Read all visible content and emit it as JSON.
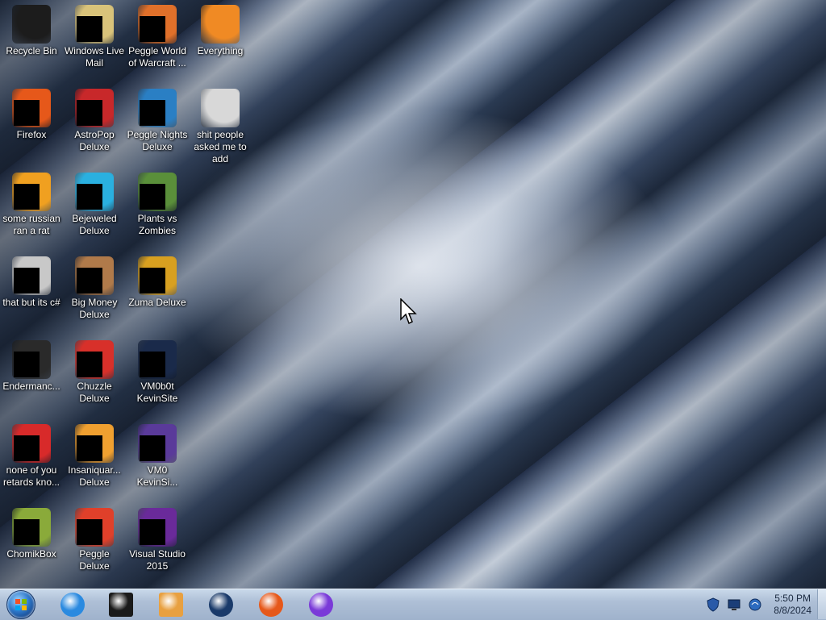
{
  "desktop": {
    "icons": [
      {
        "label": "Recycle Bin",
        "icon": "recycle-bin-icon",
        "color": "#1c1c1c"
      },
      {
        "label": "Windows Live\nMail",
        "icon": "mail-icon",
        "color": "#d9c37a"
      },
      {
        "label": "Peggle World\nof Warcraft ...",
        "icon": "peggle-wow-icon",
        "color": "#e0702a"
      },
      {
        "label": "Everything",
        "icon": "search-circle-icon",
        "color": "#f08a24"
      },
      {
        "label": "Firefox",
        "icon": "firefox-icon",
        "color": "#e6581a"
      },
      {
        "label": "AstroPop\nDeluxe",
        "icon": "astropop-icon",
        "color": "#c8282a"
      },
      {
        "label": "Peggle Nights\nDeluxe",
        "icon": "peggle-nights-icon",
        "color": "#2a7fc4"
      },
      {
        "label": "shit people\nasked me to\nadd",
        "icon": "folder-icon",
        "color": "#d8d8d8"
      },
      {
        "label": "some russian\nran a rat",
        "icon": "ae-app-icon",
        "color": "#f0a020"
      },
      {
        "label": "Bejeweled\nDeluxe",
        "icon": "bejeweled-icon",
        "color": "#2ab0e0"
      },
      {
        "label": "Plants vs\nZombies",
        "icon": "pvz-icon",
        "color": "#5a8f3a"
      },
      {
        "label": "that but its c#",
        "icon": "copy-windows-icon",
        "color": "#c8c8c8"
      },
      {
        "label": "Big Money\nDeluxe",
        "icon": "money-bag-icon",
        "color": "#b07a4a"
      },
      {
        "label": "Zuma Deluxe",
        "icon": "zuma-icon",
        "color": "#d8a020"
      },
      {
        "label": "Endermanc...",
        "icon": "terminal-window-icon",
        "color": "#2a2a2a"
      },
      {
        "label": "Chuzzle\nDeluxe",
        "icon": "chuzzle-icon",
        "color": "#d8302a"
      },
      {
        "label": "VM0b0t\nKevinSite",
        "icon": "vm-window-icon",
        "color": "#1a2a4a"
      },
      {
        "label": "none of you\nretards kno...",
        "icon": "red-circle-icon",
        "color": "#d82a2a"
      },
      {
        "label": "Insaniquar...\nDeluxe",
        "icon": "fish-icon",
        "color": "#f0a030"
      },
      {
        "label": "VM0\nKevinSi...",
        "icon": "vm-purple-icon",
        "color": "#5a3a9a"
      },
      {
        "label": "ChomikBox",
        "icon": "chomikbox-icon",
        "color": "#8aaa3a"
      },
      {
        "label": "Peggle Deluxe",
        "icon": "peggle-icon",
        "color": "#e0402a"
      },
      {
        "label": "Visual Studio\n2015",
        "icon": "visual-studio-icon",
        "color": "#6a2a9a"
      }
    ]
  },
  "taskbar": {
    "start": "start-orb",
    "pinned": [
      {
        "name": "internet-explorer-icon",
        "color": "#2a8ae0"
      },
      {
        "name": "command-prompt-icon",
        "color": "#1a1a1a"
      },
      {
        "name": "media-player-icon",
        "color": "#e8a040"
      },
      {
        "name": "globe-app-icon",
        "color": "#1a3a6a"
      },
      {
        "name": "firefox-icon",
        "color": "#e6581a"
      },
      {
        "name": "discord-like-icon",
        "color": "#7a3ad8"
      }
    ],
    "tray": [
      "shield-icon",
      "monitor-icon",
      "network-icon"
    ],
    "clock": {
      "time": "5:50 PM",
      "date": "8/8/2024"
    }
  }
}
